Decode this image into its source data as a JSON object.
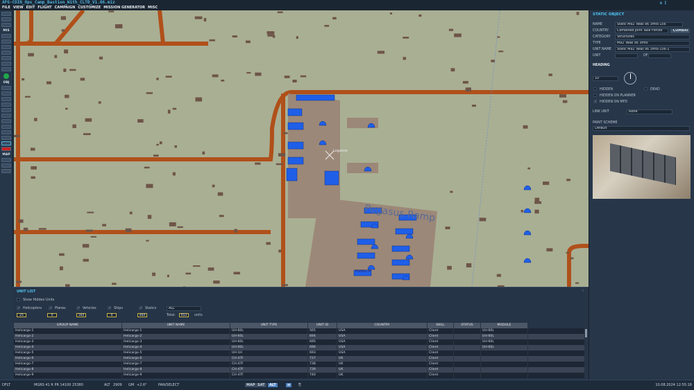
{
  "window": {
    "title": "AFG-COIN_Ops_Camp_Bastion_With_CLTD_V1.06.miz"
  },
  "menu": [
    "FILE",
    "VIEW",
    "EDIT",
    "FLIGHT",
    "CAMPAIGN",
    "CUSTOMIZE",
    "MISSION GENERATOR",
    "MISC"
  ],
  "left_toolbar": {
    "sections": [
      "MIS",
      "OBJ",
      "MAP"
    ]
  },
  "map": {
    "labels": {
      "ramp": "Pegasus Ramp",
      "zone": "Logzone",
      "pgs": "PGS01-H"
    },
    "colors": {
      "terrain": "#a9af93",
      "road": "#b0501a",
      "apron": "#9c8878",
      "building": "#6e5548",
      "unit": "#1f5fe8"
    }
  },
  "static_object": {
    "title": "STATIC OBJECT",
    "name_label": "NAME",
    "name": "Static M92 Twall x6 3mts-156",
    "country_label": "COUNTRY",
    "country": "Combined Joint Task Forces",
    "combat": "COMBAT",
    "category_label": "CATEGORY",
    "category": "Structures",
    "type_label": "TYPE",
    "type": "M92 Twall x6 3mts",
    "unit_name_label": "UNIT NAME",
    "unit_name": "Static M92 Twall x6 3mts-156-1",
    "unit_label": "UNIT",
    "of_label": "OF",
    "heading_label": "HEADING",
    "heading": "10",
    "hidden": "HIDDEN",
    "dead": "DEAD",
    "hidden_planner": "HIDDEN ON PLANNER",
    "hidden_mfd": "HIDDEN ON MFD",
    "link_unit_label": "LINK UNIT",
    "link_unit": "None",
    "paint_label": "PAINT SCHEME",
    "paint": "Default"
  },
  "unit_list": {
    "title": "UNIT LIST",
    "show_hidden": "Show Hidden Units",
    "filters": [
      {
        "label": "Helicopters",
        "count": "25"
      },
      {
        "label": "Planes",
        "count": "0"
      },
      {
        "label": "Vehicles",
        "count": "164"
      },
      {
        "label": "Ships",
        "count": "0"
      },
      {
        "label": "Statics",
        "count": "464"
      }
    ],
    "coalition": "ALL",
    "total_label": "Total:",
    "total": "653",
    "units_label": "units",
    "columns": [
      "GROUP NAME",
      "UNIT NAME",
      "UNIT TYPE",
      "UNIT ID",
      "COUNTRY",
      "SKILL",
      "STATUS",
      "MODULE"
    ],
    "rows": [
      [
        "Helicargo-1",
        "Helicargo-1",
        "UH-60L",
        "565",
        "USA",
        "Client",
        "",
        "UH-60L"
      ],
      [
        "Helicargo-2",
        "Helicargo-2",
        "UH-60L",
        "694",
        "USA",
        "Client",
        "",
        "UH-60L"
      ],
      [
        "Helicargo-3",
        "Helicargo-3",
        "UH-60L",
        "695",
        "USA",
        "Client",
        "",
        "UH-60L"
      ],
      [
        "Helicargo-4",
        "Helicargo-4",
        "UH-60L",
        "696",
        "USA",
        "Client",
        "",
        "UH-60L"
      ],
      [
        "Helicargo-5",
        "Helicargo-5",
        "UH-1H",
        "693",
        "USA",
        "Client",
        "",
        ""
      ],
      [
        "Helicargo-6",
        "Helicargo-6",
        "CH-47F",
        "737",
        "UK",
        "Client",
        "",
        ""
      ],
      [
        "Helicargo-7",
        "Helicargo-7",
        "CH-47F",
        "738",
        "UK",
        "Client",
        "",
        ""
      ],
      [
        "Helicargo-8",
        "Helicargo-8",
        "CH-47F",
        "739",
        "UK",
        "Client",
        "",
        ""
      ],
      [
        "Helicargo-9",
        "Helicargo-9",
        "CH-47F",
        "740",
        "UK",
        "Client",
        "",
        ""
      ]
    ]
  },
  "status_bar": {
    "mode": "DFLT",
    "coords": "MGRS  41 R PR 14100 25380",
    "alt_label": "ALT",
    "alt": "2909",
    "gm_label": "GM",
    "gm": "+2.6°",
    "tool": "PAN/SELECT",
    "map_btn": "MAP",
    "sat_btn": "SAT",
    "alt_btn": "ALT",
    "datetime": "10.08.2024 12:55:18"
  }
}
